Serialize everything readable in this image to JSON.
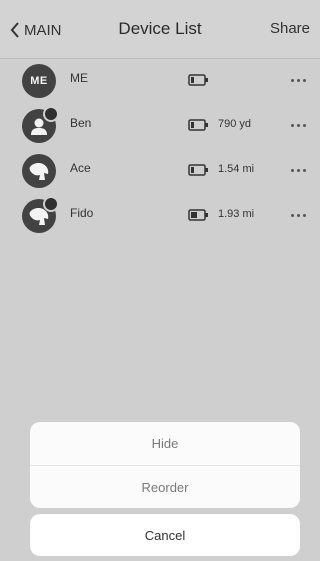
{
  "nav": {
    "back_label": "MAIN",
    "title": "Device List",
    "share_label": "Share"
  },
  "devices": [
    {
      "name": "ME",
      "avatar_type": "initials",
      "avatar_initials": "ME",
      "distance": "",
      "battery_level": 0.25,
      "has_badge": false
    },
    {
      "name": "Ben",
      "avatar_type": "person-icon",
      "distance": "790 yd",
      "battery_level": 0.25,
      "has_badge": true
    },
    {
      "name": "Ace",
      "avatar_type": "dog-icon",
      "distance": "1.54 mi",
      "battery_level": 0.25,
      "has_badge": false
    },
    {
      "name": "Fido",
      "avatar_type": "dog-icon",
      "distance": "1.93 mi",
      "battery_level": 0.5,
      "has_badge": true
    }
  ],
  "action_sheet": {
    "hide_label": "Hide",
    "reorder_label": "Reorder",
    "cancel_label": "Cancel"
  },
  "colors": {
    "background": "#cfcfcf",
    "avatar": "#424242",
    "sheet": "#fbfbfb"
  },
  "icons": {
    "back": "chevron-left-icon",
    "battery": "battery-icon",
    "more": "more-horizontal-icon",
    "person": "person-icon",
    "dog": "dog-icon"
  }
}
